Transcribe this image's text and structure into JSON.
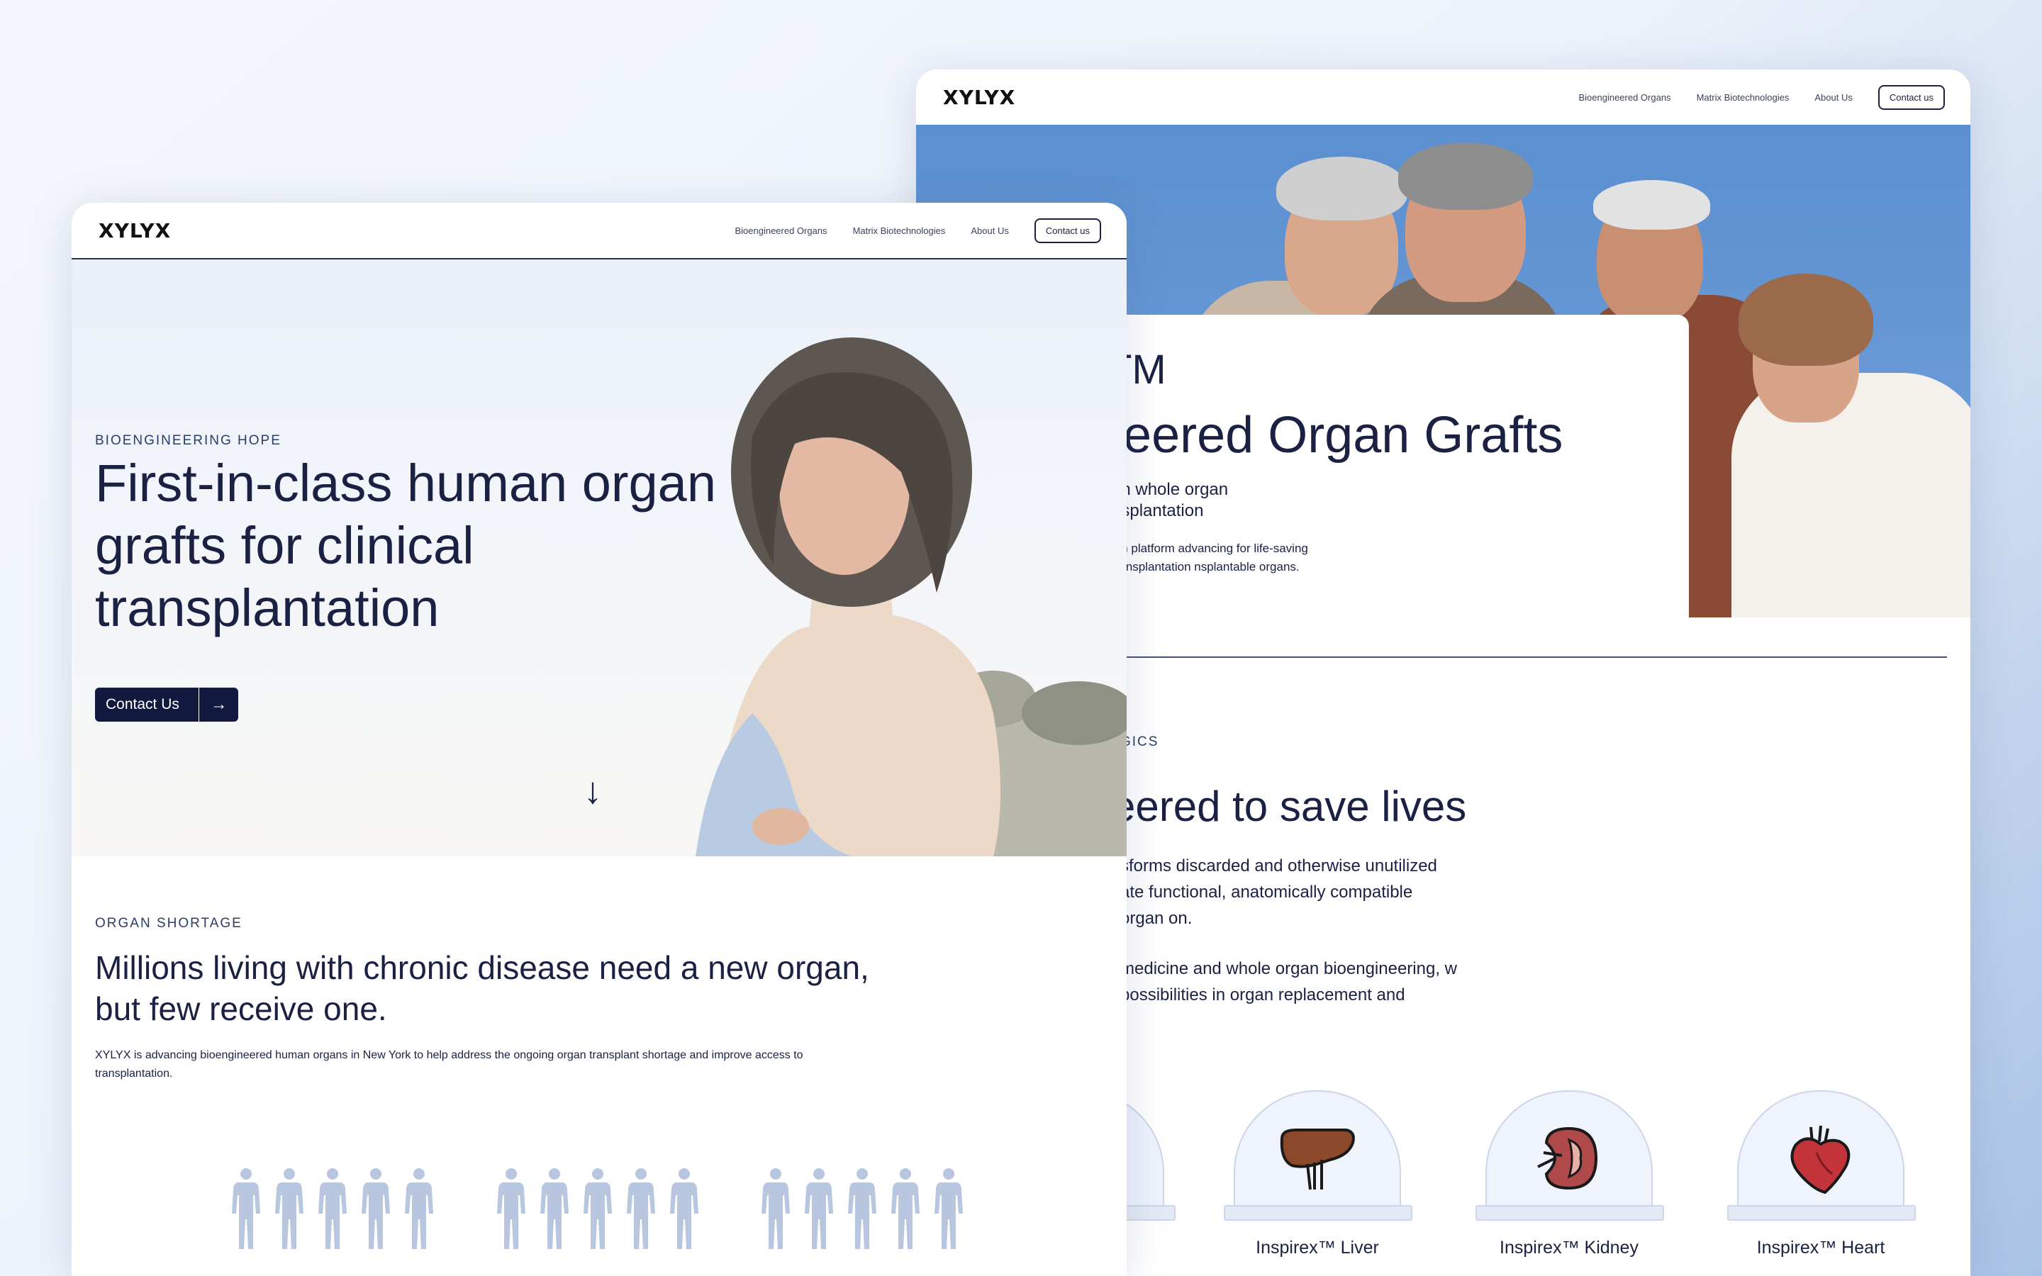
{
  "nav": {
    "logo": "XYLYX",
    "links": [
      "Bioengineered Organs",
      "Matrix Biotechnologies",
      "About Us"
    ],
    "contact": "Contact us"
  },
  "back": {
    "title_partial": "xTM",
    "subtitle_partial": "ineered Organ Grafts",
    "sub_partial": "an whole organ nsplantation",
    "sub2_partial": "ion platform advancing for life-saving transplantation nsplantable organs.",
    "eyebrow_partial": "GICS",
    "h2_partial": "eered to save lives",
    "p1_partial": "sforms discarded and otherwise unutilized ate functional, anatomically compatible organ on.",
    "p2_partial": "medicine and whole organ bioengineering, w possibilities in organ replacement and",
    "organs": [
      {
        "label": "Inspirex™ Liver",
        "icon": "liver-icon"
      },
      {
        "label": "Inspirex™ Kidney",
        "icon": "kidney-icon"
      },
      {
        "label": "Inspirex™ Heart",
        "icon": "heart-icon"
      }
    ]
  },
  "front": {
    "eyebrow": "BIOENGINEERING HOPE",
    "headline": "First-in-class human organ grafts for clinical transplantation",
    "cta": "Contact Us",
    "cta_arrow": "→",
    "down_arrow": "↓",
    "section_eyebrow": "ORGAN SHORTAGE",
    "section_heading": "Millions living with chronic disease need a new organ, but few receive one.",
    "section_body": "XYLYX is advancing bioengineered human organs in New York to help address the ongoing organ transplant shortage and improve access to transplantation."
  },
  "colors": {
    "navy": "#1a2143",
    "sky": "#5b8fd0",
    "figure": "#b8c6df",
    "organ_red": "#c2333a",
    "organ_brown": "#8a4a2a"
  }
}
